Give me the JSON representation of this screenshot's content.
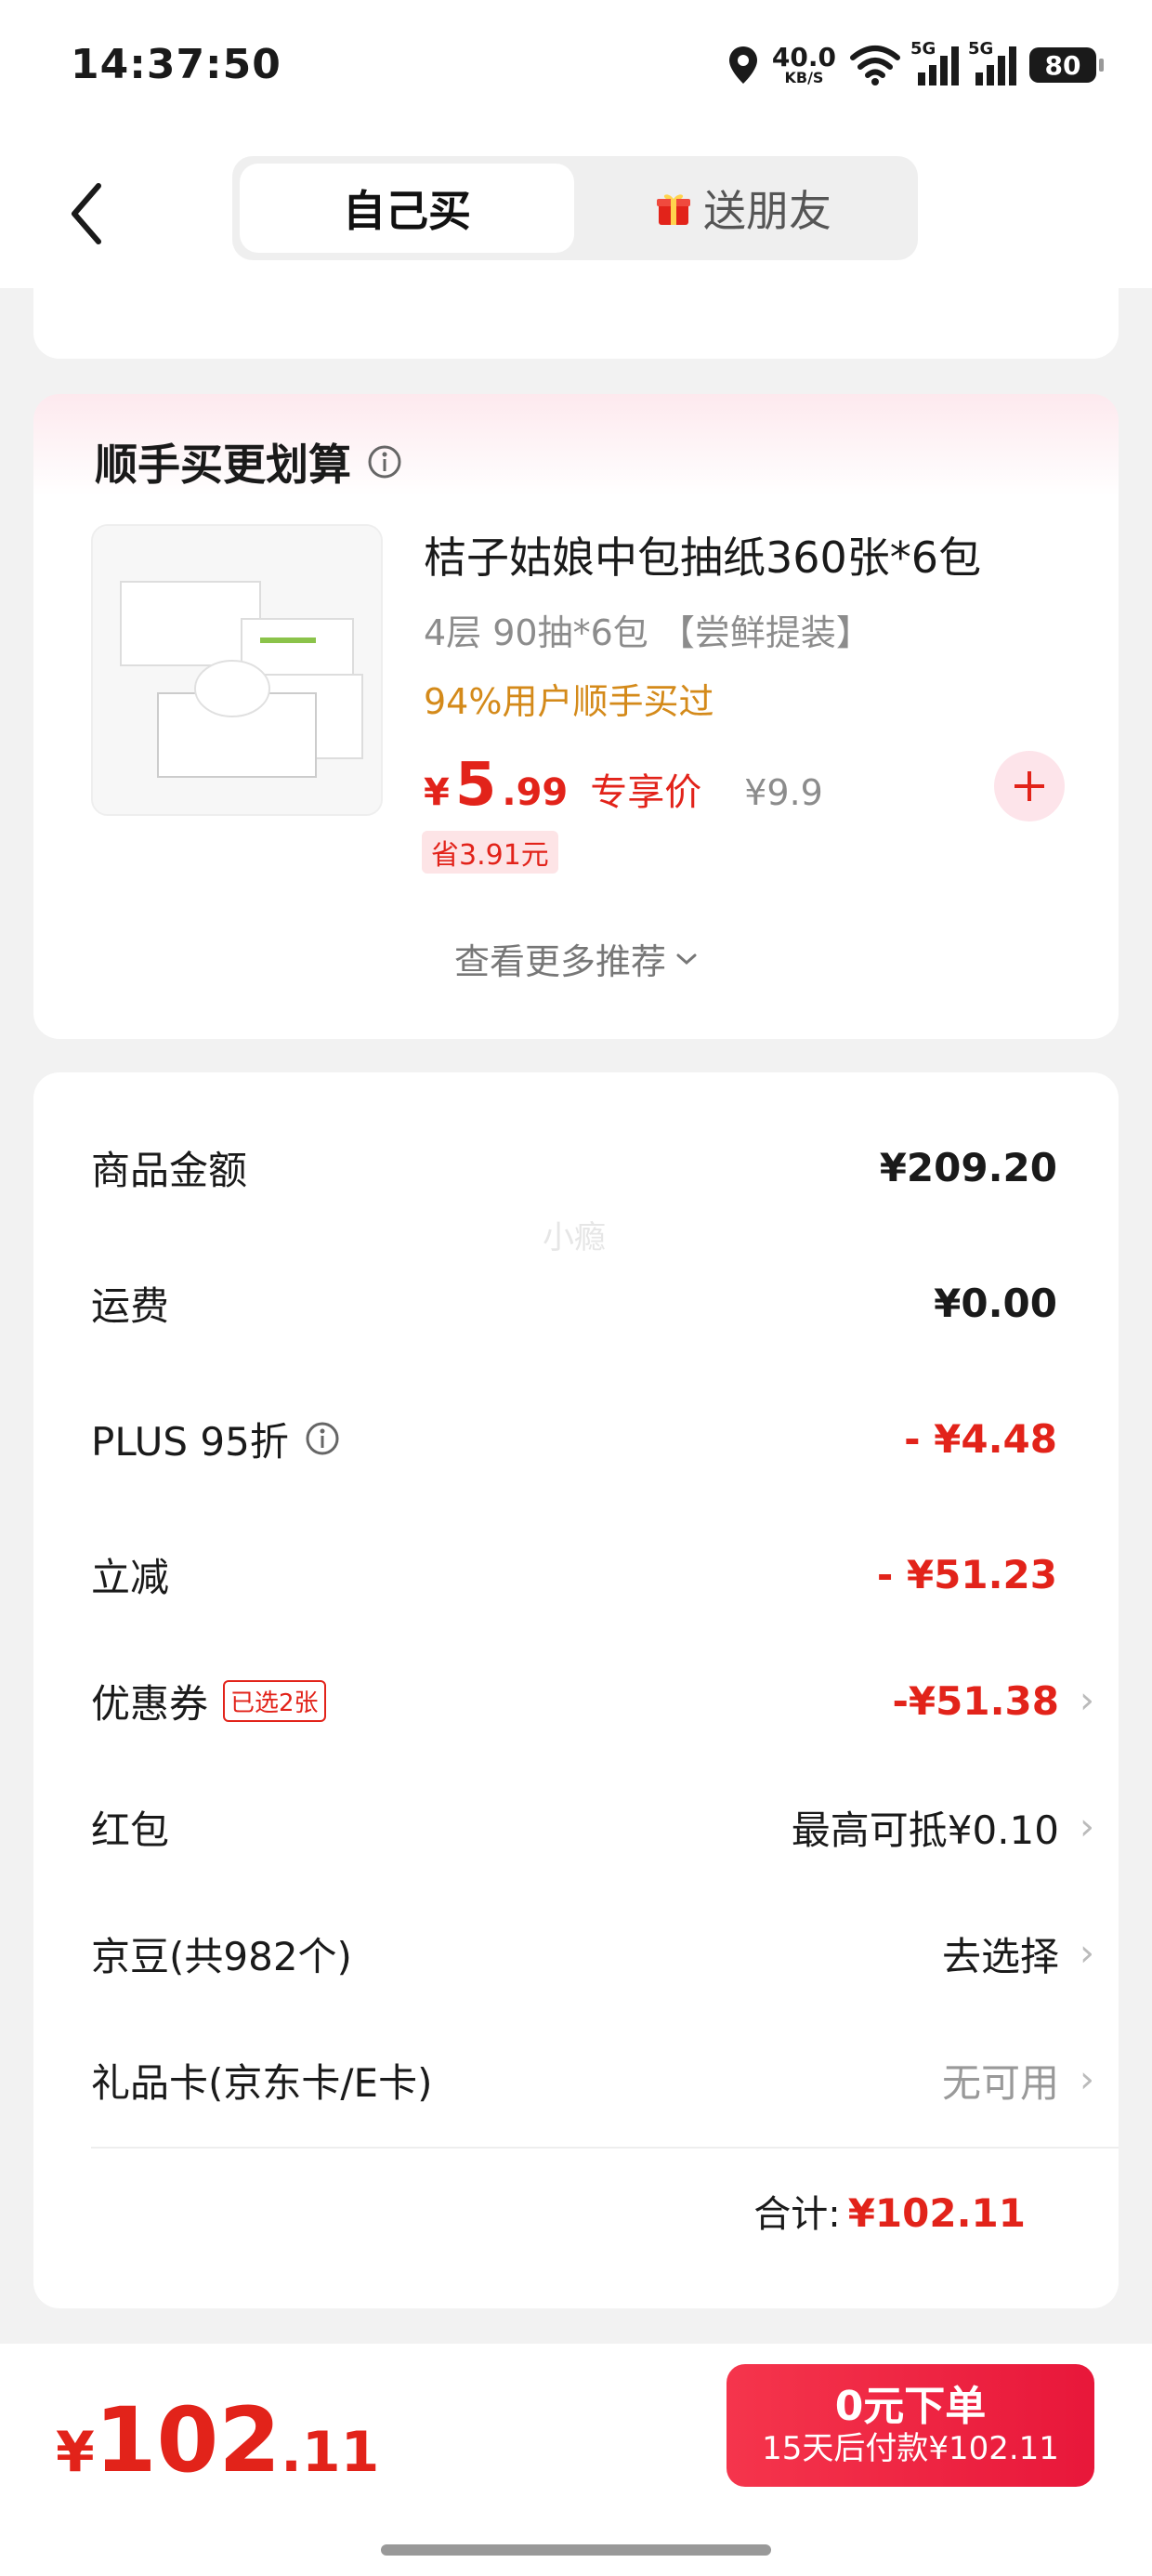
{
  "status_bar": {
    "time": "14:37:50",
    "speed_value": "40.0",
    "speed_unit": "KB/S",
    "net1": "5G",
    "net2": "5G",
    "battery": "80"
  },
  "header": {
    "tab_self": "自己买",
    "tab_gift": "送朋友"
  },
  "recommend": {
    "title": "顺手买更划算",
    "product_title": "桔子姑娘中包抽纸360张*6包",
    "product_spec": "4层 90抽*6包 【尝鲜提装】",
    "product_rate": "94%用户顺手买过",
    "price_symbol": "¥",
    "price_int": "5",
    "price_dec": ".99",
    "price_label": "专享价",
    "orig_price": "¥9.9",
    "save_label": "省3.91元",
    "more_label": "查看更多推荐"
  },
  "summary": {
    "rows": [
      {
        "label": "商品金额",
        "value": "¥209.20"
      },
      {
        "label": "运费",
        "value": "¥0.00"
      },
      {
        "label": "PLUS 95折",
        "value": "- ¥4.48"
      },
      {
        "label": "立减",
        "value": "- ¥51.23"
      },
      {
        "label": "优惠券",
        "tag": "已选2张",
        "value": "-¥51.38"
      },
      {
        "label": "红包",
        "value": "最高可抵¥0.10"
      },
      {
        "label": "京豆(共982个)",
        "value": "去选择"
      },
      {
        "label": "礼品卡(京东卡/E卡)",
        "value": "无可用"
      }
    ],
    "total_label": "合计:",
    "total_value": "¥102.11",
    "watermark": "小瘾"
  },
  "bottom": {
    "price_symbol": "¥",
    "price_int": "102",
    "price_dec": ".11",
    "order_main": "0元下单",
    "order_sub": "15天后付款¥102.11"
  },
  "colors": {
    "accent": "#e2231a",
    "rate": "#d48a1a"
  },
  "icons": [
    "back-arrow-icon",
    "gift-icon",
    "info-icon",
    "plus-icon",
    "chevron-down-icon",
    "chevron-right-icon",
    "location-icon",
    "wifi-icon",
    "signal-icon",
    "battery-icon"
  ]
}
